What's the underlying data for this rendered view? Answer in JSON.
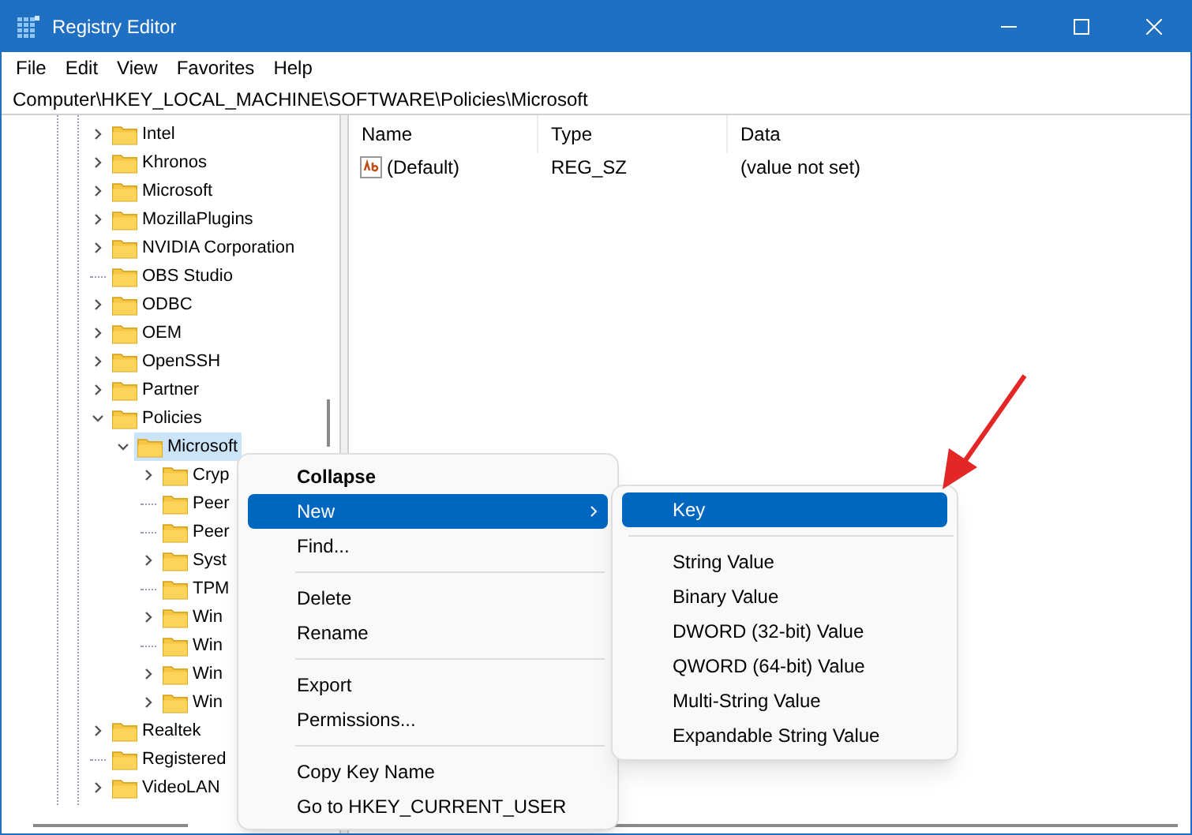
{
  "window": {
    "title": "Registry Editor"
  },
  "menu_bar": [
    "File",
    "Edit",
    "View",
    "Favorites",
    "Help"
  ],
  "address": "Computer\\HKEY_LOCAL_MACHINE\\SOFTWARE\\Policies\\Microsoft",
  "tree": [
    {
      "label": "Intel",
      "expandable": true,
      "expanded": false,
      "selected": false
    },
    {
      "label": "Khronos",
      "expandable": true,
      "expanded": false,
      "selected": false
    },
    {
      "label": "Microsoft",
      "expandable": true,
      "expanded": false,
      "selected": false
    },
    {
      "label": "MozillaPlugins",
      "expandable": true,
      "expanded": false,
      "selected": false
    },
    {
      "label": "NVIDIA Corporation",
      "expandable": true,
      "expanded": false,
      "selected": false
    },
    {
      "label": "OBS Studio",
      "expandable": false,
      "selected": false
    },
    {
      "label": "ODBC",
      "expandable": true,
      "expanded": false,
      "selected": false
    },
    {
      "label": "OEM",
      "expandable": true,
      "expanded": false,
      "selected": false
    },
    {
      "label": "OpenSSH",
      "expandable": true,
      "expanded": false,
      "selected": false
    },
    {
      "label": "Partner",
      "expandable": true,
      "expanded": false,
      "selected": false
    },
    {
      "label": "Policies",
      "expandable": true,
      "expanded": true,
      "selected": false,
      "children": [
        {
          "label": "Microsoft",
          "expandable": true,
          "expanded": true,
          "selected": true,
          "children": [
            {
              "label": "Cryp",
              "expandable": true,
              "expanded": false,
              "selected": false
            },
            {
              "label": "Peer",
              "expandable": false,
              "selected": false
            },
            {
              "label": "Peer",
              "expandable": false,
              "selected": false
            },
            {
              "label": "Syst",
              "expandable": true,
              "expanded": false,
              "selected": false
            },
            {
              "label": "TPM",
              "expandable": false,
              "selected": false
            },
            {
              "label": "Win",
              "expandable": true,
              "expanded": false,
              "selected": false
            },
            {
              "label": "Win",
              "expandable": false,
              "selected": false
            },
            {
              "label": "Win",
              "expandable": true,
              "expanded": false,
              "selected": false
            },
            {
              "label": "Win",
              "expandable": true,
              "expanded": false,
              "selected": false
            }
          ]
        }
      ]
    },
    {
      "label": "Realtek",
      "expandable": true,
      "expanded": false,
      "selected": false
    },
    {
      "label": "Registered",
      "expandable": false,
      "selected": false
    },
    {
      "label": "VideoLAN",
      "expandable": true,
      "expanded": false,
      "selected": false
    }
  ],
  "list": {
    "columns": [
      "Name",
      "Type",
      "Data"
    ],
    "rows": [
      {
        "name": "(Default)",
        "type": "REG_SZ",
        "data": "(value not set)"
      }
    ]
  },
  "context_menu": [
    {
      "kind": "item",
      "label": "Collapse",
      "default": true,
      "selected": false,
      "submenu": false
    },
    {
      "kind": "item",
      "label": "New",
      "default": false,
      "selected": true,
      "submenu": true
    },
    {
      "kind": "item",
      "label": "Find...",
      "default": false,
      "selected": false,
      "submenu": false
    },
    {
      "kind": "separator"
    },
    {
      "kind": "item",
      "label": "Delete",
      "default": false,
      "selected": false,
      "submenu": false
    },
    {
      "kind": "item",
      "label": "Rename",
      "default": false,
      "selected": false,
      "submenu": false
    },
    {
      "kind": "separator"
    },
    {
      "kind": "item",
      "label": "Export",
      "default": false,
      "selected": false,
      "submenu": false
    },
    {
      "kind": "item",
      "label": "Permissions...",
      "default": false,
      "selected": false,
      "submenu": false
    },
    {
      "kind": "separator"
    },
    {
      "kind": "item",
      "label": "Copy Key Name",
      "default": false,
      "selected": false,
      "submenu": false
    },
    {
      "kind": "item",
      "label": "Go to HKEY_CURRENT_USER",
      "default": false,
      "selected": false,
      "submenu": false
    }
  ],
  "submenu": [
    {
      "kind": "item",
      "label": "Key",
      "selected": true
    },
    {
      "kind": "separator"
    },
    {
      "kind": "item",
      "label": "String Value",
      "selected": false
    },
    {
      "kind": "item",
      "label": "Binary Value",
      "selected": false
    },
    {
      "kind": "item",
      "label": "DWORD (32-bit) Value",
      "selected": false
    },
    {
      "kind": "item",
      "label": "QWORD (64-bit) Value",
      "selected": false
    },
    {
      "kind": "item",
      "label": "Multi-String Value",
      "selected": false
    },
    {
      "kind": "item",
      "label": "Expandable String Value",
      "selected": false
    }
  ]
}
